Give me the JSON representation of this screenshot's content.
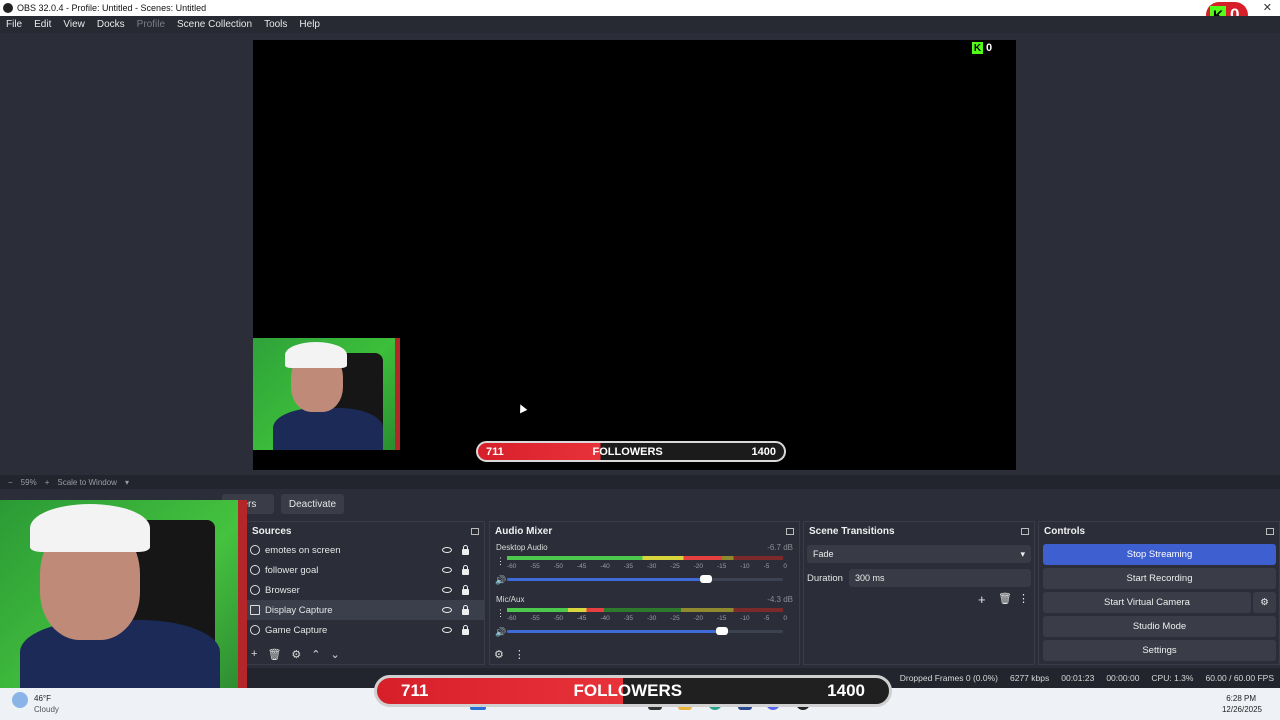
{
  "titlebar": {
    "title": "OBS 32.0.4 - Profile: Untitled - Scenes: Untitled",
    "close": "✕"
  },
  "menu": [
    "File",
    "Edit",
    "View",
    "Docks",
    "Profile",
    "Scene Collection",
    "Tools",
    "Help"
  ],
  "preview": {
    "kick_count": "0",
    "kick_logo": "K",
    "follower_bar": {
      "current": "711",
      "label": "FOLLOWERS",
      "goal": "1400"
    }
  },
  "zoom": {
    "value": "59%",
    "scale_label": "Scale to Window"
  },
  "header_buttons": {
    "filters": "ters",
    "deactivate": "Deactivate"
  },
  "sources": {
    "title": "Sources",
    "items": [
      {
        "name": "emotes on screen",
        "icon": "globe-icon"
      },
      {
        "name": "follower goal",
        "icon": "globe-icon"
      },
      {
        "name": "Browser",
        "icon": "globe-icon"
      },
      {
        "name": "Display Capture",
        "icon": "monitor-icon"
      },
      {
        "name": "Game Capture",
        "icon": "gamepad-icon"
      }
    ]
  },
  "mixer": {
    "title": "Audio Mixer",
    "channels": [
      {
        "name": "Desktop Audio",
        "db": "-6.7 dB",
        "level": 0.78,
        "volume": 0.72
      },
      {
        "name": "Mic/Aux",
        "db": "-4.3 dB",
        "level": 0.35,
        "volume": 0.78
      }
    ],
    "scale": [
      "-60",
      "-55",
      "-50",
      "-45",
      "-40",
      "-35",
      "-30",
      "-25",
      "-20",
      "-15",
      "-10",
      "-5",
      "0"
    ]
  },
  "transitions": {
    "title": "Scene Transitions",
    "selected": "Fade",
    "duration_label": "Duration",
    "duration_value": "300 ms"
  },
  "controls": {
    "title": "Controls",
    "buttons": [
      "Stop Streaming",
      "Start Recording",
      "Start Virtual Camera",
      "Studio Mode",
      "Settings"
    ]
  },
  "status": {
    "dropped_frames": "Dropped Frames 0 (0.0%)",
    "bitrate": "6277 kbps",
    "stream_time": "00:01:23",
    "record_time": "00:00:00",
    "cpu": "CPU: 1.3%",
    "fps": "60.00 / 60.00 FPS"
  },
  "overlay_bar": {
    "current": "711",
    "label": "FOLLOWERS",
    "goal": "1400"
  },
  "kick_overlay": {
    "logo": "K",
    "count": "0"
  },
  "taskbar": {
    "weather_temp": "46°F",
    "weather_desc": "Cloudy",
    "time": "6:28 PM",
    "date": "12/26/2025"
  },
  "colors": {
    "accent": "#3d5fd0",
    "kick_green": "#53fc18",
    "follower_red": "#d71f2a"
  }
}
